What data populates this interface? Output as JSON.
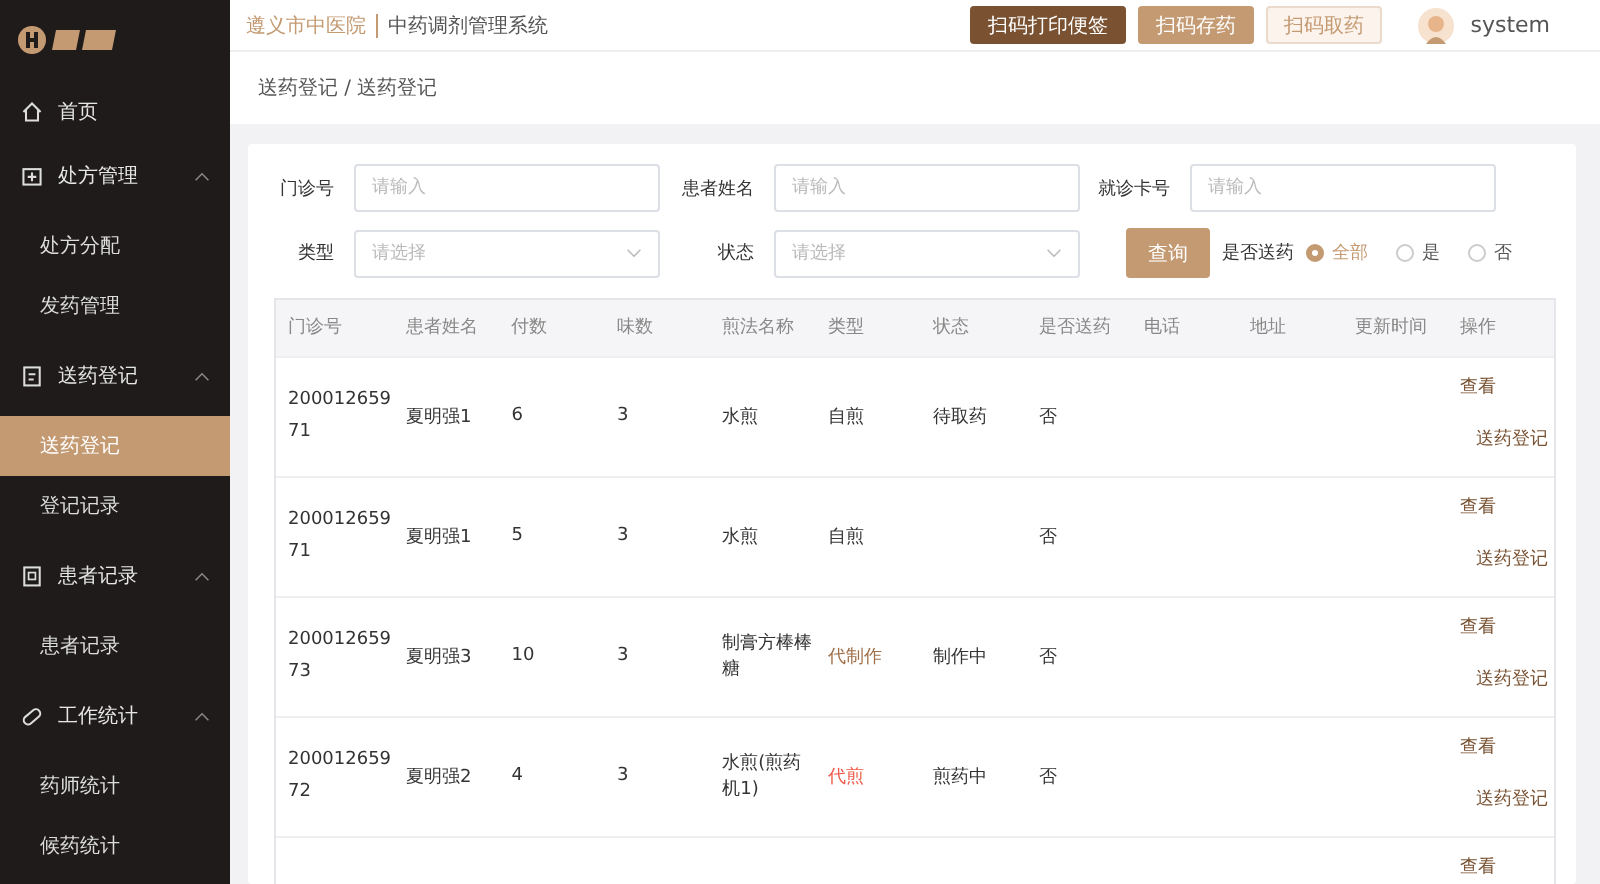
{
  "sidebar": {
    "items": [
      {
        "label": "首页"
      },
      {
        "label": "处方管理",
        "expanded": true,
        "children": [
          {
            "label": "处方分配",
            "selected": false
          },
          {
            "label": "发药管理",
            "selected": false
          }
        ]
      },
      {
        "label": "送药登记",
        "expanded": true,
        "children": [
          {
            "label": "送药登记",
            "selected": true
          },
          {
            "label": "登记记录",
            "selected": false
          }
        ]
      },
      {
        "label": "患者记录",
        "expanded": true,
        "children": [
          {
            "label": "患者记录",
            "selected": false
          }
        ]
      },
      {
        "label": "工作统计",
        "expanded": true,
        "children": [
          {
            "label": "药师统计",
            "selected": false
          },
          {
            "label": "候药统计",
            "selected": false
          }
        ]
      }
    ]
  },
  "header": {
    "hospital": "遵义市中医院",
    "system": "中药调剂管理系统",
    "buttons": [
      {
        "label": "扫码打印便签",
        "kind": "dark"
      },
      {
        "label": "扫码存药",
        "kind": "medium"
      },
      {
        "label": "扫码取药",
        "kind": "light"
      }
    ],
    "user": "system"
  },
  "breadcrumb": "送药登记 / 送药登记",
  "filters": {
    "fields": [
      {
        "label": "门诊号",
        "placeholder": "请输入",
        "kind": "input"
      },
      {
        "label": "患者姓名",
        "placeholder": "请输入",
        "kind": "input"
      },
      {
        "label": "就诊卡号",
        "placeholder": "请输入",
        "kind": "input"
      },
      {
        "label": "类型",
        "placeholder": "请选择",
        "kind": "select"
      },
      {
        "label": "状态",
        "placeholder": "请选择",
        "kind": "select"
      }
    ],
    "search_button": "查询",
    "radio_label": "是否送药",
    "radios": [
      {
        "label": "全部",
        "selected": true
      },
      {
        "label": "是",
        "selected": false
      },
      {
        "label": "否",
        "selected": false
      }
    ]
  },
  "table": {
    "columns": [
      "门诊号",
      "患者姓名",
      "付数",
      "味数",
      "煎法名称",
      "类型",
      "状态",
      "是否送药",
      "电话",
      "地址",
      "更新时间",
      "操作"
    ],
    "rows": [
      {
        "id": "20001265971",
        "name": "夏明强1",
        "doses": "6",
        "herbs": "3",
        "method": "水煎",
        "type": {
          "text": "自煎",
          "kind": "self"
        },
        "status": "待取药",
        "delivery": "否",
        "actions": [
          "查看",
          "送药登记"
        ]
      },
      {
        "id": "20001265971",
        "name": "夏明强1",
        "doses": "5",
        "herbs": "3",
        "method": "水煎",
        "type": {
          "text": "自煎",
          "kind": "self"
        },
        "delivery": "否",
        "actions": [
          "查看",
          "送药登记"
        ]
      },
      {
        "id": "20001265973",
        "name": "夏明强3",
        "doses": "10",
        "herbs": "3",
        "method": "制膏方棒棒糖",
        "type": {
          "text": "代制作",
          "kind": "make"
        },
        "status": "制作中",
        "delivery": "否",
        "actions": [
          "查看",
          "送药登记"
        ]
      },
      {
        "id": "20001265972",
        "name": "夏明强2",
        "doses": "4",
        "herbs": "3",
        "method": "水煎(煎药机1)",
        "type": {
          "text": "代煎",
          "kind": "decoct"
        },
        "status": "煎药中",
        "delivery": "否",
        "actions": [
          "查看",
          "送药登记"
        ]
      },
      {
        "actions": [
          "查看"
        ]
      }
    ]
  }
}
